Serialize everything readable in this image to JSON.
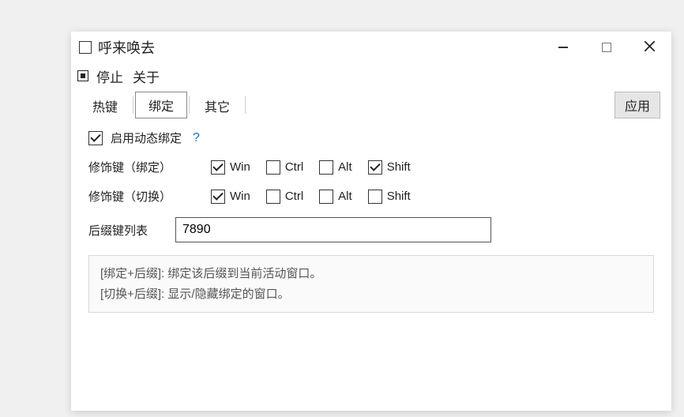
{
  "window": {
    "title": "呼来唤去"
  },
  "menu": {
    "stop": "停止",
    "about": "关于"
  },
  "tabs": {
    "hotkey": "热键",
    "binding": "绑定",
    "other": "其它",
    "apply": "应用"
  },
  "content": {
    "enable_dynamic_binding": "启用动态绑定",
    "modifier_bind_label": "修饰键（绑定）",
    "modifier_switch_label": "修饰键（切换）",
    "mod_win": "Win",
    "mod_ctrl": "Ctrl",
    "mod_alt": "Alt",
    "mod_shift": "Shift",
    "suffix_list_label": "后缀键列表",
    "suffix_value": "7890"
  },
  "state": {
    "dynamic_binding_enabled": true,
    "bind": {
      "win": true,
      "ctrl": false,
      "alt": false,
      "shift": true
    },
    "switch": {
      "win": true,
      "ctrl": false,
      "alt": false,
      "shift": false
    }
  },
  "help": {
    "line1": "[绑定+后缀]: 绑定该后缀到当前活动窗口。",
    "line2": "[切换+后缀]: 显示/隐藏绑定的窗口。"
  }
}
